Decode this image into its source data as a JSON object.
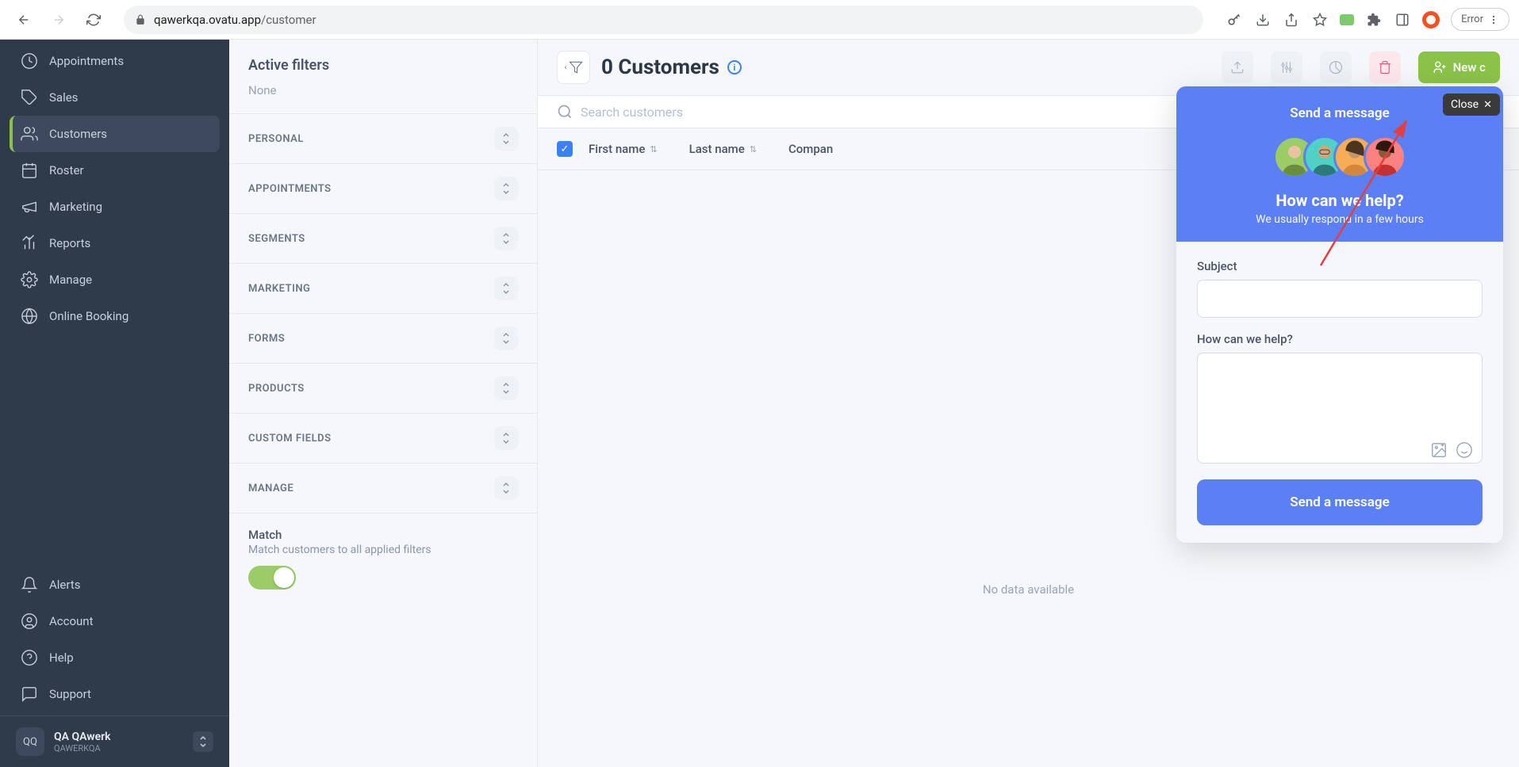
{
  "browser": {
    "url_prefix": "qawerkqa.ovatu.app",
    "url_path": "/customer",
    "error_label": "Error"
  },
  "sidebar": {
    "items": [
      {
        "label": "Appointments"
      },
      {
        "label": "Sales"
      },
      {
        "label": "Customers"
      },
      {
        "label": "Roster"
      },
      {
        "label": "Marketing"
      },
      {
        "label": "Reports"
      },
      {
        "label": "Manage"
      },
      {
        "label": "Online Booking"
      }
    ],
    "bottom_items": [
      {
        "label": "Alerts"
      },
      {
        "label": "Account"
      },
      {
        "label": "Help"
      },
      {
        "label": "Support"
      }
    ],
    "user": {
      "initials": "QQ",
      "name": "QA QAwerk",
      "sub": "QAWERKQA"
    }
  },
  "filters": {
    "title": "Active filters",
    "none": "None",
    "sections": [
      "PERSONAL",
      "APPOINTMENTS",
      "SEGMENTS",
      "MARKETING",
      "FORMS",
      "PRODUCTS",
      "CUSTOM FIELDS",
      "MANAGE"
    ],
    "match_title": "Match",
    "match_sub": "Match customers to all applied filters"
  },
  "content": {
    "title": "0 Customers",
    "new_button": "New c",
    "search_placeholder": "Search customers",
    "columns": [
      "First name",
      "Last name",
      "Compan"
    ],
    "no_data": "No data available"
  },
  "help_widget": {
    "top_title": "Send a message",
    "question": "How can we help?",
    "respond": "We usually respond in a few hours",
    "subject_label": "Subject",
    "body_label": "How can we help?",
    "send_button": "Send a message"
  },
  "close": {
    "label": "Close"
  }
}
